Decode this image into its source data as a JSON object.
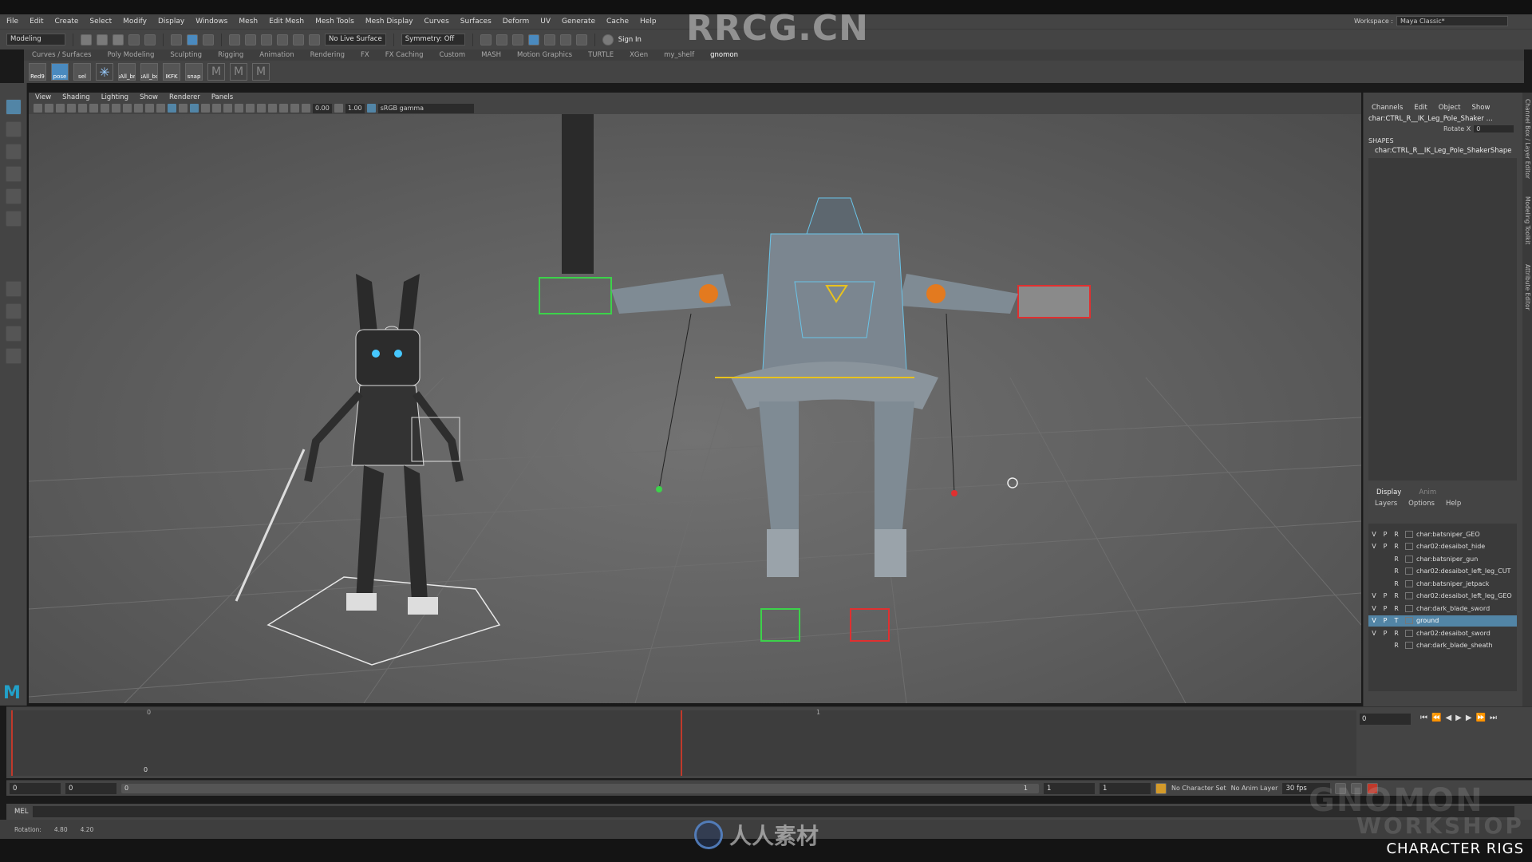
{
  "menubar": [
    "File",
    "Edit",
    "Create",
    "Select",
    "Modify",
    "Display",
    "Windows",
    "Mesh",
    "Edit Mesh",
    "Mesh Tools",
    "Mesh Display",
    "Curves",
    "Surfaces",
    "Deform",
    "UV",
    "Generate",
    "Cache",
    "Help"
  ],
  "workspace": {
    "label": "Workspace :",
    "value": "Maya Classic*"
  },
  "statusline": {
    "mode": "Modeling",
    "live_surface": "No Live Surface",
    "symmetry": "Symmetry: Off",
    "sign_in": "Sign In"
  },
  "shelf_tabs": [
    "Curves / Surfaces",
    "Poly Modeling",
    "Sculpting",
    "Rigging",
    "Animation",
    "Rendering",
    "FX",
    "FX Caching",
    "Custom",
    "MASH",
    "Motion Graphics",
    "TURTLE",
    "XGen",
    "my_shelf",
    "gnomon"
  ],
  "shelf_active": "gnomon",
  "shelf_buttons": [
    "Red9",
    "pose",
    "sel",
    "",
    "sAll_bn",
    "sAll_bo",
    "IKFK",
    "snap",
    "",
    "",
    ""
  ],
  "panel_menu": [
    "View",
    "Shading",
    "Lighting",
    "Show",
    "Renderer",
    "Panels"
  ],
  "panel_toolbar": {
    "exposure": "0.00",
    "gamma": "1.00",
    "colorspace": "sRGB gamma"
  },
  "channel_box": {
    "tabs": [
      "Channels",
      "Edit",
      "Object",
      "Show"
    ],
    "node": "char:CTRL_R__IK_Leg_Pole_Shaker ...",
    "attr_label": "Rotate X",
    "attr_value": "0",
    "shapes_label": "SHAPES",
    "shape_node": "char:CTRL_R__IK_Leg_Pole_ShakerShape"
  },
  "layer_editor": {
    "tabs": [
      "Display",
      "Anim"
    ],
    "menu": [
      "Layers",
      "Options",
      "Help"
    ],
    "layers": [
      {
        "v": "V",
        "p": "P",
        "r": "R",
        "name": "char:batsniper_GEO",
        "selected": false
      },
      {
        "v": "V",
        "p": "P",
        "r": "R",
        "name": "char02:desaibot_hide",
        "selected": false
      },
      {
        "v": "",
        "p": "",
        "r": "R",
        "name": "char:batsniper_gun",
        "selected": false
      },
      {
        "v": "",
        "p": "",
        "r": "R",
        "name": "char02:desaibot_left_leg_CUT",
        "selected": false
      },
      {
        "v": "",
        "p": "",
        "r": "R",
        "name": "char:batsniper_jetpack",
        "selected": false
      },
      {
        "v": "V",
        "p": "P",
        "r": "R",
        "name": "char02:desaibot_left_leg_GEO",
        "selected": false
      },
      {
        "v": "V",
        "p": "P",
        "r": "R",
        "name": "char:dark_blade_sword",
        "selected": false
      },
      {
        "v": "V",
        "p": "P",
        "r": "T",
        "name": "ground",
        "selected": true
      },
      {
        "v": "V",
        "p": "P",
        "r": "R",
        "name": "char02:desaibot_sword",
        "selected": false
      },
      {
        "v": "",
        "p": "",
        "r": "R",
        "name": "char:dark_blade_sheath",
        "selected": false
      }
    ]
  },
  "side_tabs": [
    "Channel Box / Layer Editor",
    "Modeling Toolkit",
    "Attribute Editor"
  ],
  "timeline": {
    "tick_start": "0",
    "tick_start_low": "0",
    "tick_end": "1",
    "current_frame": "0"
  },
  "range": {
    "start": "0",
    "anim_start": "0",
    "slider_start": "0",
    "slider_end": "1",
    "end": "1",
    "anim_end": "1",
    "character_set": "No Character Set",
    "anim_layer": "No Anim Layer",
    "fps": "30 fps"
  },
  "cmdline": {
    "label": "MEL"
  },
  "helpline": {
    "label": "Rotation:",
    "v1": "4.80",
    "v2": "4.20"
  },
  "watermarks": {
    "top": "RRCG.CN",
    "bottom": "人人素材",
    "gnomon1": "GNOMON",
    "gnomon2": "WORKSHOP"
  },
  "caption": "CHARACTER RIGS",
  "colors": {
    "accent_blue": "#5285a6",
    "playhead": "#c0392b",
    "maya_logo": "#22a0c8"
  }
}
